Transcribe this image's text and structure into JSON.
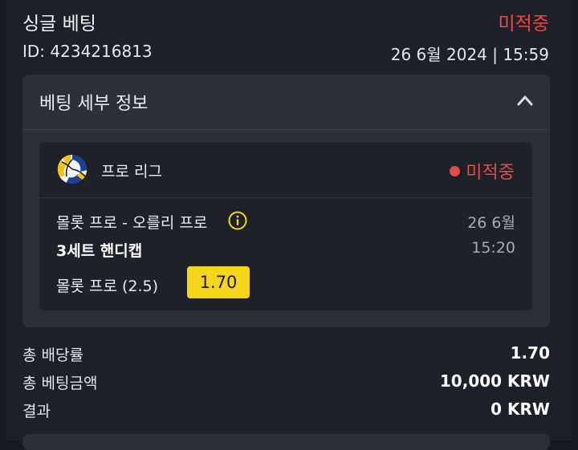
{
  "header": {
    "title": "싱글 베팅",
    "status": "미적중",
    "id_text": "ID: 4234216813",
    "date_text": "26 6월 2024 | 15:59"
  },
  "details": {
    "title": "베팅 세부 정보",
    "card": {
      "league": "프로 리그",
      "status": "미적중",
      "match": "몰롯 프로 - 오를리 프로",
      "date": "26 6월",
      "market": "3세트 핸디캡",
      "time": "15:20",
      "selection": "몰롯 프로 (2.5)",
      "odds": "1.70"
    }
  },
  "summary": {
    "rows": [
      {
        "label": "총 배당률",
        "value": "1.70"
      },
      {
        "label": "총 베팅금액",
        "value": "10,000 KRW"
      },
      {
        "label": "결과",
        "value": "0 KRW"
      }
    ]
  },
  "colors": {
    "lost_status": "#e84848",
    "odds_badge": "#f5d61b",
    "background": "#1d2127",
    "panel": "#2b2f36"
  },
  "icons": {
    "sport": "volleyball-icon",
    "collapse": "chevron-up-icon",
    "info": "info-icon"
  }
}
